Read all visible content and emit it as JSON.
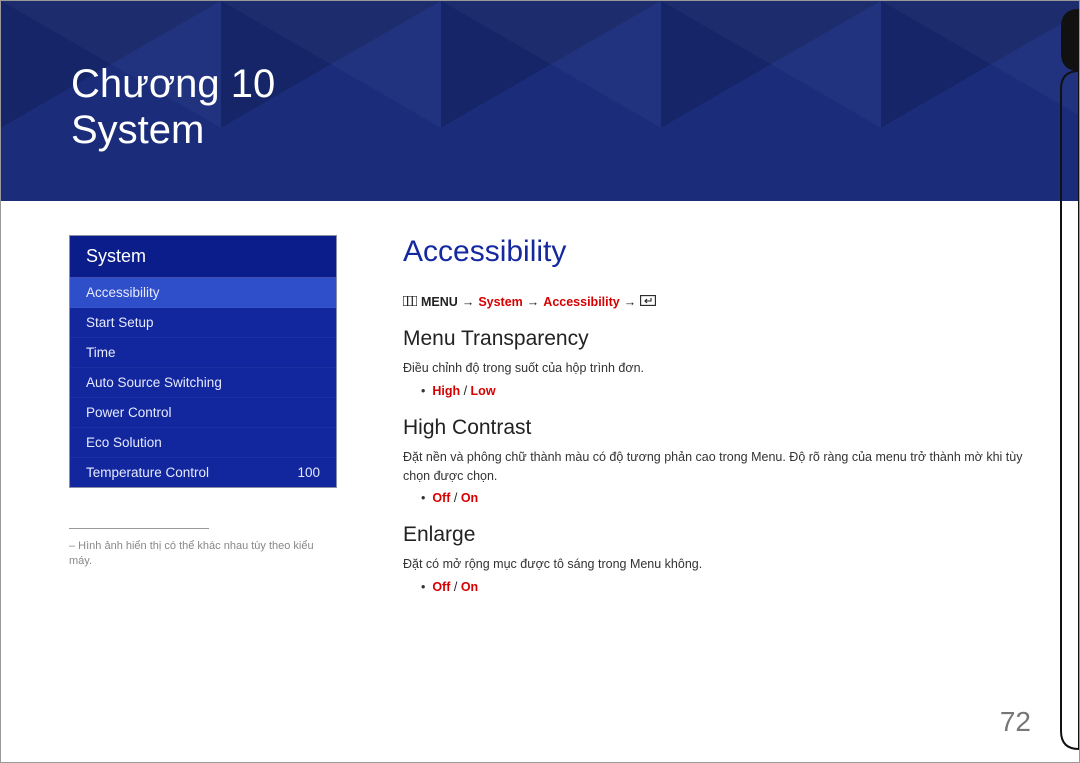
{
  "hero": {
    "chapter": "Chương 10",
    "title": "System"
  },
  "sidebar": {
    "title": "System",
    "items": [
      {
        "label": "Accessibility",
        "value": "",
        "active": true
      },
      {
        "label": "Start Setup",
        "value": ""
      },
      {
        "label": "Time",
        "value": ""
      },
      {
        "label": "Auto Source Switching",
        "value": ""
      },
      {
        "label": "Power Control",
        "value": ""
      },
      {
        "label": "Eco Solution",
        "value": ""
      },
      {
        "label": "Temperature Control",
        "value": "100"
      }
    ],
    "footnote": "– Hình ảnh hiển thị có thể khác nhau tùy theo kiểu máy."
  },
  "main": {
    "title": "Accessibility",
    "breadcrumb": {
      "menu": "MENU",
      "arrow": "→",
      "system": "System",
      "accessibility": "Accessibility"
    },
    "sections": [
      {
        "heading": "Menu Transparency",
        "desc": "Điều chỉnh độ trong suốt của hộp trình đơn.",
        "options": [
          "High",
          "Low"
        ]
      },
      {
        "heading": "High Contrast",
        "desc": "Đặt nền và phông chữ thành màu có độ tương phản cao trong Menu. Độ rõ ràng của menu trở thành mờ khi tùy chọn được chọn.",
        "options": [
          "Off",
          "On"
        ]
      },
      {
        "heading": "Enlarge",
        "desc": "Đặt có mở rộng mục được tô sáng trong Menu không.",
        "options": [
          "Off",
          "On"
        ]
      }
    ]
  },
  "page_number": "72"
}
